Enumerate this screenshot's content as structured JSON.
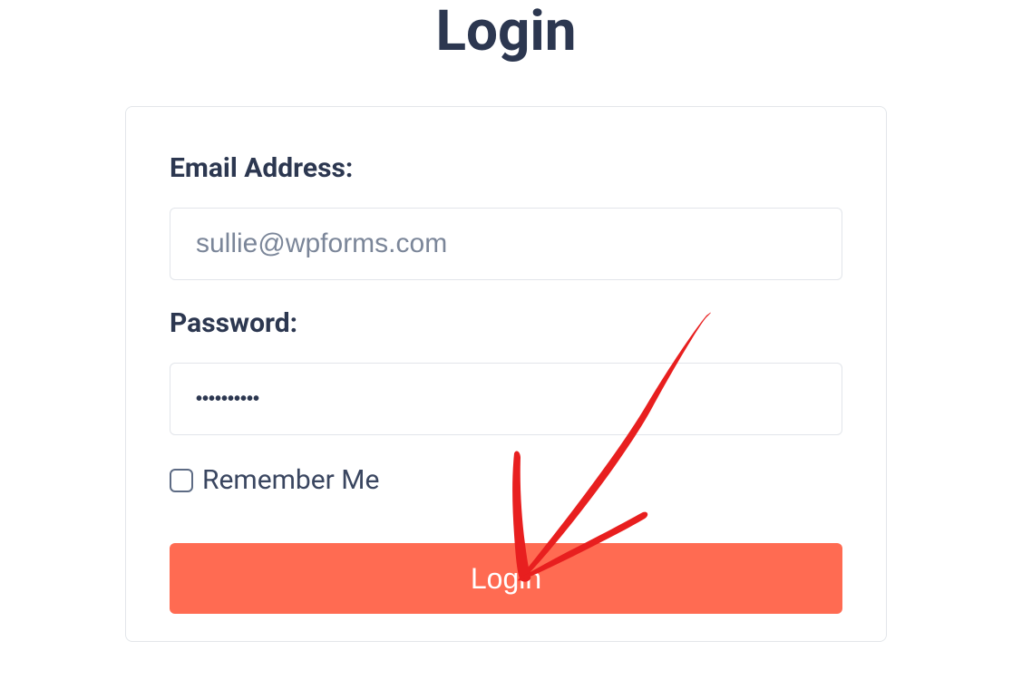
{
  "page": {
    "title": "Login"
  },
  "form": {
    "email_label": "Email Address:",
    "email_placeholder": "sullie@wpforms.com",
    "password_label": "Password:",
    "password_value": "••••••••••",
    "remember_label": "Remember Me",
    "submit_label": "Login"
  }
}
